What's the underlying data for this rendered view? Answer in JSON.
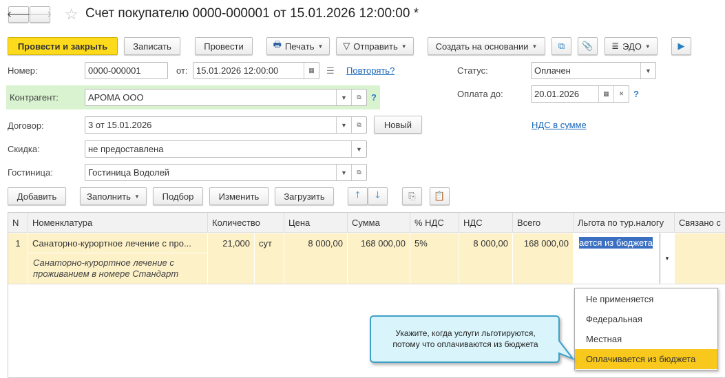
{
  "header": {
    "title": "Счет покупателю 0000-000001 от 15.01.2026 12:00:00 *"
  },
  "toolbar": {
    "post_close": "Провести и закрыть",
    "save": "Записать",
    "post": "Провести",
    "print": "Печать",
    "send": "Отправить",
    "create_based": "Создать на основании",
    "edo": "ЭДО"
  },
  "form": {
    "number_label": "Номер:",
    "number": "0000-000001",
    "date_label": "от:",
    "date": "15.01.2026 12:00:00",
    "repeat_link": "Повторять?",
    "counterparty_label": "Контрагент:",
    "counterparty": "АРОМА ООО",
    "contract_label": "Договор:",
    "contract": "3 от 15.01.2026",
    "new_button": "Новый",
    "discount_label": "Скидка:",
    "discount": "не предоставлена",
    "hotel_label": "Гостиница:",
    "hotel": "Гостиница Водолей",
    "status_label": "Статус:",
    "status": "Оплачен",
    "pay_until_label": "Оплата до:",
    "pay_until": "20.01.2026",
    "vat_link": "НДС в сумме",
    "help": "?"
  },
  "table_toolbar": {
    "add": "Добавить",
    "fill": "Заполнить",
    "pick": "Подбор",
    "edit": "Изменить",
    "load": "Загрузить"
  },
  "table": {
    "columns": [
      "N",
      "Номенклатура",
      "Количество",
      "Цена",
      "Сумма",
      "% НДС",
      "НДС",
      "Всего",
      "Льгота по тур.налогу",
      "Связано с"
    ],
    "rows": [
      {
        "n": "1",
        "item": "Санаторно-курортное лечение с про...",
        "item_desc": "Санаторно-курортное лечение с проживанием в номере Стандарт",
        "qty": "21,000",
        "unit": "сут",
        "price": "8 000,00",
        "sum": "168 000,00",
        "vat_rate": "5%",
        "vat": "8 000,00",
        "total": "168 000,00",
        "benefit": "ается из бюджета"
      }
    ]
  },
  "dropdown": {
    "options": [
      "Не применяется",
      "Федеральная",
      "Местная",
      "Оплачивается из бюджета"
    ],
    "selected": "Оплачивается из бюджета"
  },
  "callout": {
    "text": "Укажите, когда услуги льготируются, потому что оплачиваются из бюджета"
  },
  "colors": {
    "primary": "#fddb1c",
    "row_bg": "#fdf1c8",
    "highlight": "#f9c81c",
    "link": "#1a66b8",
    "counterparty_bg": "#d9f2cf",
    "callout_bg": "#d9f5fb"
  }
}
